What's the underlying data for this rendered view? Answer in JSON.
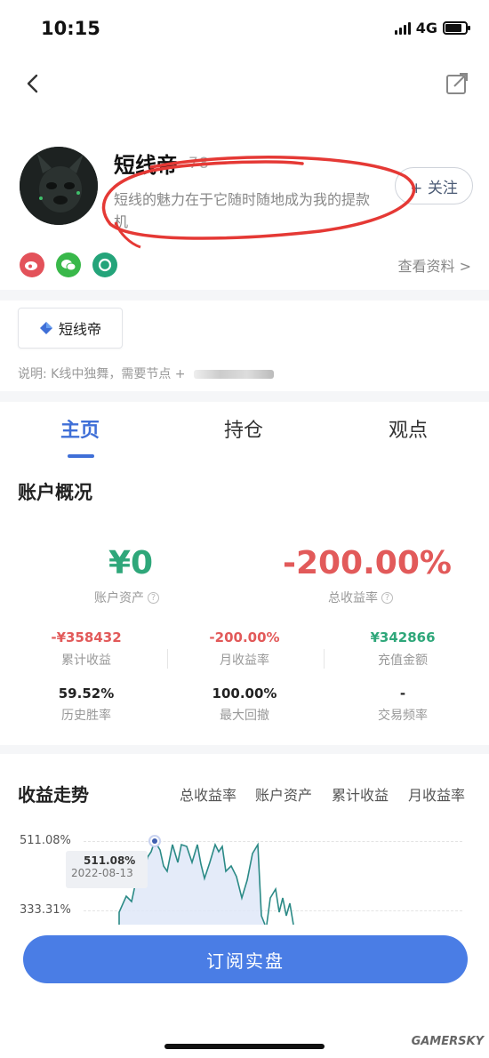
{
  "status_bar": {
    "time": "10:15",
    "network": "4G"
  },
  "profile": {
    "name": "短线帝",
    "name_extra": "78",
    "bio": "短线的魅力在于它随时随地成为我的提款机",
    "follow_label": "+ 关注",
    "view_profile_label": "查看资料 >"
  },
  "tag": {
    "label": "短线帝"
  },
  "note": "说明: K线中独舞，需要节点 +",
  "tabs": [
    {
      "label": "主页"
    },
    {
      "label": "持仓"
    },
    {
      "label": "观点"
    }
  ],
  "overview": {
    "title": "账户概况",
    "assets_value": "¥0",
    "assets_label": "账户资产",
    "return_value": "-200.00%",
    "return_label": "总收益率",
    "stats": [
      {
        "value": "-¥358432",
        "label": "累计收益"
      },
      {
        "value": "-200.00%",
        "label": "月收益率"
      },
      {
        "value": "¥342866",
        "label": "充值金额"
      },
      {
        "value": "59.52%",
        "label": "历史胜率"
      },
      {
        "value": "100.00%",
        "label": "最大回撤"
      },
      {
        "value": "-",
        "label": "交易频率"
      }
    ],
    "colors": {
      "green": "#2fa77a",
      "red": "#e25a5a",
      "accent": "#3f6fd7"
    }
  },
  "trend": {
    "title": "收益走势",
    "tabs": [
      "总收益率",
      "账户资产",
      "累计收益",
      "月收益率"
    ],
    "y_labels": [
      "511.08%",
      "333.31%"
    ],
    "tooltip_value": "511.08%",
    "tooltip_date": "2022-08-13"
  },
  "subscribe_label": "订阅实盘",
  "watermark": "GAMERSKY"
}
